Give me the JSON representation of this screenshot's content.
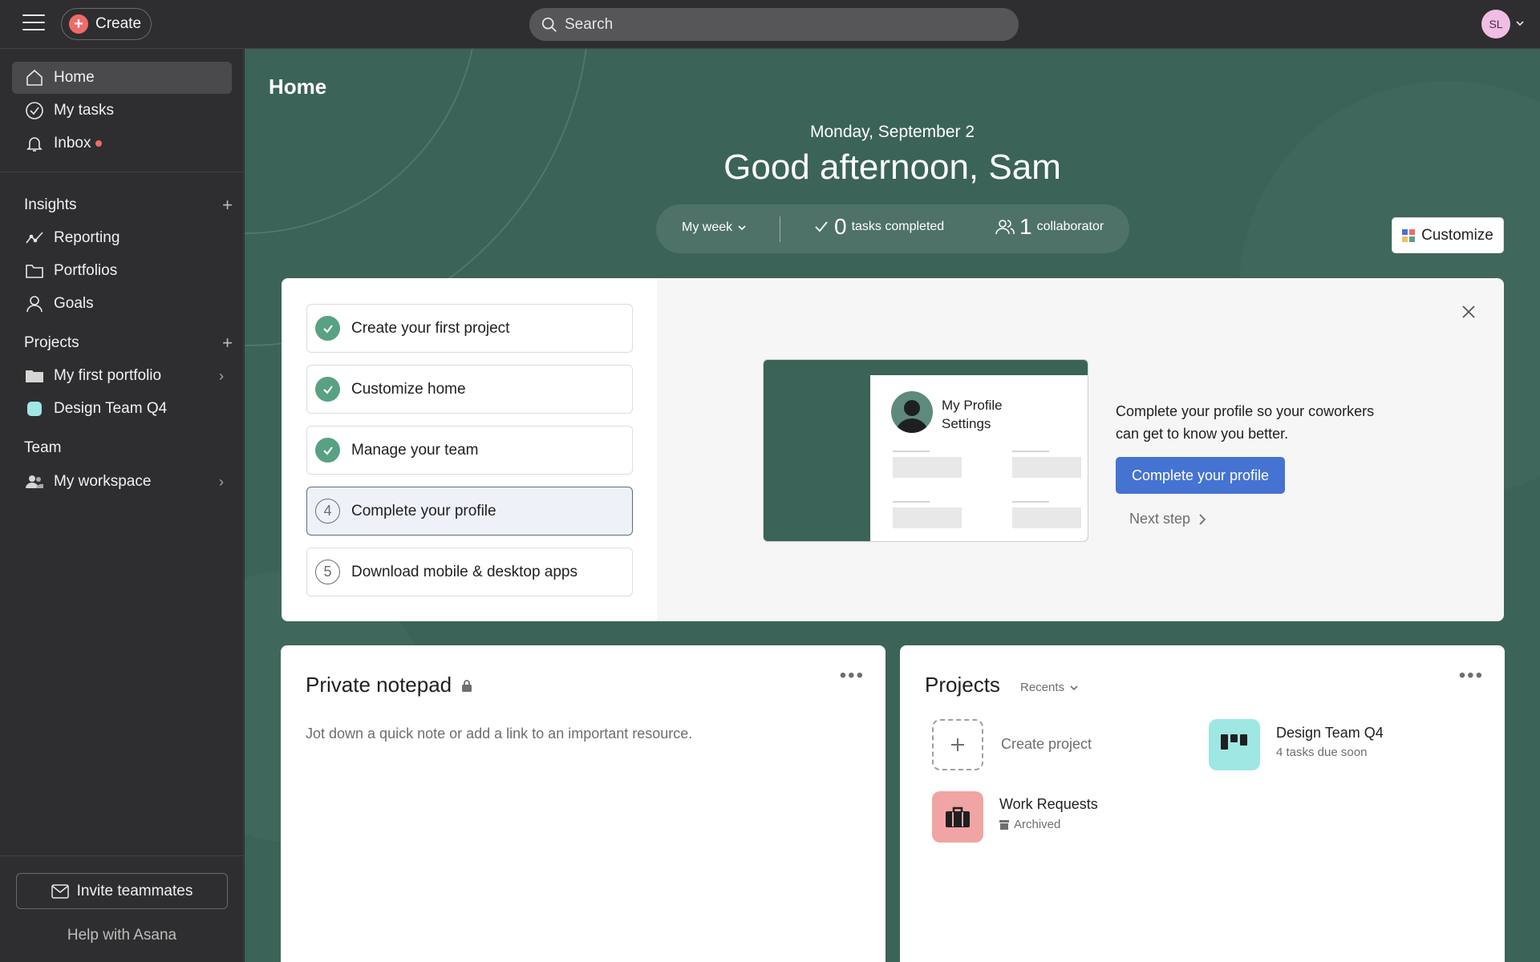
{
  "topbar": {
    "create_label": "Create",
    "search_placeholder": "Search",
    "avatar_initials": "SL"
  },
  "sidebar": {
    "nav": [
      {
        "label": "Home",
        "icon": "home-icon"
      },
      {
        "label": "My tasks",
        "icon": "check-circle-icon"
      },
      {
        "label": "Inbox",
        "icon": "bell-icon"
      }
    ],
    "insights_heading": "Insights",
    "insights": [
      {
        "label": "Reporting",
        "icon": "line-chart-icon"
      },
      {
        "label": "Portfolios",
        "icon": "folder-icon"
      },
      {
        "label": "Goals",
        "icon": "person-icon"
      }
    ],
    "projects_heading": "Projects",
    "projects": [
      {
        "label": "My first portfolio",
        "icon": "folder-filled-icon"
      },
      {
        "label": "Design Team Q4",
        "color": "#9ee7e3"
      }
    ],
    "team_heading": "Team",
    "team": [
      {
        "label": "My workspace",
        "icon": "people-icon"
      }
    ],
    "invite_label": "Invite teammates",
    "help_label": "Help with Asana"
  },
  "main": {
    "title": "Home",
    "date": "Monday, September 2",
    "greeting": "Good afternoon, Sam",
    "stats": {
      "period": "My week",
      "tasks_count": "0",
      "tasks_label": "tasks completed",
      "collab_count": "1",
      "collab_label": "collaborator"
    },
    "customize_label": "Customize"
  },
  "onboarding": {
    "steps": [
      {
        "label": "Create your first project",
        "done": true
      },
      {
        "label": "Customize home",
        "done": true
      },
      {
        "label": "Manage your team",
        "done": true
      },
      {
        "label": "Complete your profile",
        "num": "4",
        "current": true
      },
      {
        "label": "Download mobile & desktop apps",
        "num": "5"
      }
    ],
    "illustration_title": "My Profile Settings",
    "description": "Complete your profile so your coworkers can get to know you better.",
    "primary_button": "Complete your profile",
    "next_step": "Next step"
  },
  "notepad": {
    "title": "Private notepad",
    "placeholder": "Jot down a quick note or add a link to an important resource."
  },
  "projects_card": {
    "title": "Projects",
    "filter": "Recents",
    "create_label": "Create project",
    "items": [
      {
        "name": "Design Team Q4",
        "sub": "4 tasks due soon",
        "color": "#9ee7e3"
      },
      {
        "name": "Work Requests",
        "sub": "Archived",
        "color": "#f1a4a4"
      }
    ]
  },
  "colors": {
    "accent_green": "#3b6358",
    "primary_blue": "#4573d2",
    "create_red": "#f06a6a",
    "check_green": "#58a182"
  }
}
